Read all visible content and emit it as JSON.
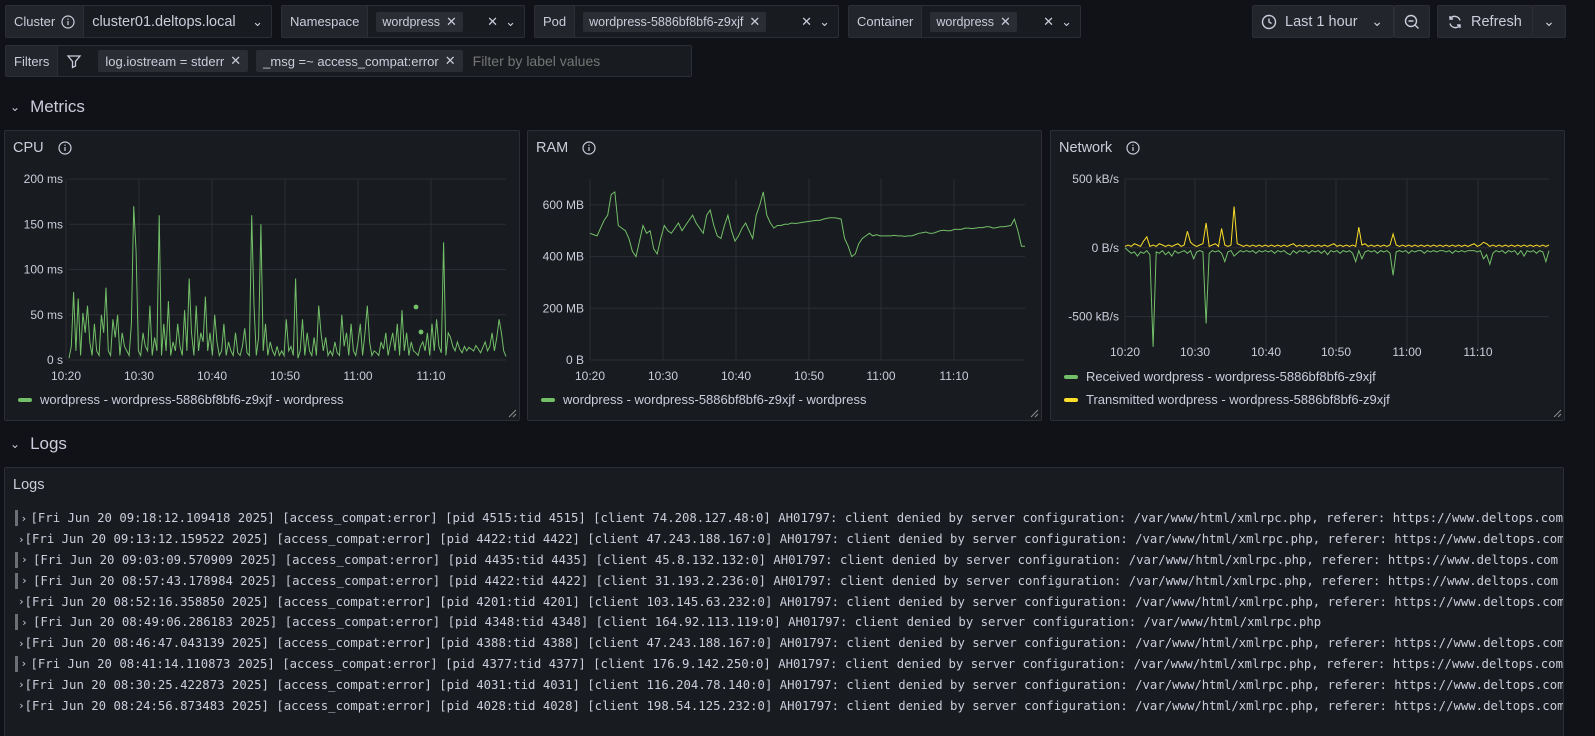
{
  "variables": {
    "cluster": {
      "label": "Cluster",
      "value": "cluster01.deltops.local"
    },
    "namespace": {
      "label": "Namespace",
      "value": "wordpress"
    },
    "pod": {
      "label": "Pod",
      "value": "wordpress-5886bf8bf6-z9xjf"
    },
    "container": {
      "label": "Container",
      "value": "wordpress"
    }
  },
  "filters": {
    "label": "Filters",
    "chips": [
      "log.iostream = stderr",
      "_msg =~ access_compat:error"
    ],
    "placeholder": "Filter by label values"
  },
  "toolbar": {
    "time_range": "Last 1 hour",
    "refresh_label": "Refresh"
  },
  "sections": {
    "metrics": "Metrics",
    "logs": "Logs"
  },
  "colors": {
    "green": "#73bf69",
    "yellow": "#fade2a"
  },
  "panels": {
    "cpu": {
      "title": "CPU",
      "legend": "wordpress - wordpress-5886bf8bf6-z9xjf - wordpress",
      "y_ticks": [
        "200 ms",
        "150 ms",
        "100 ms",
        "50 ms",
        "0 s"
      ],
      "x_ticks": [
        "10:20",
        "10:30",
        "10:40",
        "10:50",
        "11:00",
        "11:10"
      ]
    },
    "ram": {
      "title": "RAM",
      "legend": "wordpress - wordpress-5886bf8bf6-z9xjf - wordpress",
      "y_ticks": [
        "600 MB",
        "400 MB",
        "200 MB",
        "0 B"
      ],
      "x_ticks": [
        "10:20",
        "10:30",
        "10:40",
        "10:50",
        "11:00",
        "11:10"
      ]
    },
    "network": {
      "title": "Network",
      "legend_received": "Received wordpress - wordpress-5886bf8bf6-z9xjf",
      "legend_transmitted": "Transmitted wordpress - wordpress-5886bf8bf6-z9xjf",
      "y_ticks": [
        "500 kB/s",
        "0 B/s",
        "-500 kB/s"
      ],
      "x_ticks": [
        "10:20",
        "10:30",
        "10:40",
        "10:50",
        "11:00",
        "11:10"
      ]
    }
  },
  "chart_data": [
    {
      "type": "line",
      "title": "CPU",
      "ylim": [
        0,
        200
      ],
      "x_range": [
        "10:15",
        "11:19"
      ],
      "series": [
        {
          "name": "wordpress - wordpress-5886bf8bf6-z9xjf - wordpress",
          "values": [
            2,
            15,
            75,
            10,
            68,
            5,
            52,
            30,
            60,
            20,
            5,
            40,
            10,
            5,
            50,
            30,
            80,
            10,
            5,
            45,
            25,
            50,
            5,
            30,
            15,
            10,
            5,
            40,
            170,
            120,
            10,
            5,
            30,
            15,
            10,
            60,
            5,
            25,
            10,
            160,
            5,
            40,
            10,
            65,
            5,
            20,
            10,
            40,
            15,
            5,
            55,
            10,
            90,
            30,
            5,
            60,
            10,
            30,
            20,
            70,
            10,
            30,
            5,
            50,
            20,
            5,
            10,
            40,
            5,
            20,
            10,
            5,
            30,
            8,
            5,
            15,
            35,
            8,
            5,
            160,
            60,
            5,
            25,
            150,
            10,
            40,
            5,
            20,
            10,
            5,
            15,
            5,
            10,
            5,
            45,
            10,
            15,
            5,
            90,
            2,
            10,
            45,
            5,
            30,
            10,
            5,
            25,
            5,
            60,
            30,
            10,
            25,
            5,
            10,
            5,
            20,
            8,
            5,
            50,
            15,
            30,
            5,
            40,
            10,
            5,
            20,
            40,
            5,
            30,
            60,
            20,
            5,
            10,
            8,
            5,
            20,
            12,
            30,
            5,
            18,
            30,
            10,
            40,
            5,
            55,
            10,
            30,
            5,
            20,
            10,
            8,
            5,
            15,
            20,
            10,
            30,
            5,
            40,
            10,
            45,
            15,
            8,
            130,
            5,
            30,
            25,
            15,
            10,
            20,
            12,
            8,
            15,
            10,
            14,
            12,
            10,
            16,
            12,
            8,
            14,
            20,
            10,
            15,
            30,
            10,
            25,
            45,
            30,
            10,
            4
          ]
        }
      ]
    },
    {
      "type": "line",
      "title": "RAM",
      "ylim": [
        0,
        700
      ],
      "x_range": [
        "10:15",
        "11:19"
      ],
      "series": [
        {
          "name": "wordpress - wordpress-5886bf8bf6-z9xjf - wordpress",
          "values": [
            490,
            485,
            480,
            510,
            540,
            560,
            640,
            650,
            520,
            510,
            500,
            470,
            420,
            400,
            460,
            520,
            490,
            500,
            430,
            410,
            470,
            520,
            500,
            490,
            510,
            530,
            500,
            520,
            540,
            560,
            530,
            510,
            490,
            560,
            580,
            520,
            480,
            470,
            520,
            560,
            500,
            460,
            480,
            510,
            530,
            500,
            470,
            560,
            600,
            650,
            560,
            530,
            510,
            520,
            520,
            525,
            525,
            530,
            528,
            530,
            532,
            534,
            536,
            538,
            540,
            540,
            545,
            548,
            550,
            550,
            548,
            545,
            470,
            440,
            400,
            410,
            450,
            470,
            480,
            490,
            480,
            485,
            480,
            480,
            480,
            480,
            482,
            480,
            480,
            478,
            480,
            480,
            485,
            490,
            492,
            495,
            490,
            490,
            495,
            500,
            502,
            500,
            500,
            505,
            505,
            505,
            510,
            510,
            508,
            510,
            512,
            512,
            515,
            515,
            510,
            512,
            515,
            515,
            518,
            520,
            545,
            500,
            440,
            440
          ]
        }
      ]
    },
    {
      "type": "line",
      "title": "Network",
      "ylim": [
        -750,
        500
      ],
      "x_range": [
        "10:18",
        "11:19"
      ],
      "series": [
        {
          "name": "Received wordpress - wordpress-5886bf8bf6-z9xjf",
          "values": [
            0,
            -20,
            -40,
            -30,
            -60,
            -30,
            -40,
            -20,
            -50,
            -720,
            -30,
            -40,
            -20,
            -50,
            -30,
            -60,
            -20,
            -40,
            -30,
            -20,
            -40,
            -20,
            -80,
            -30,
            -20,
            -30,
            -550,
            -40,
            -20,
            -30,
            -20,
            -40,
            -100,
            -30,
            -20,
            -60,
            -40,
            -20,
            -30,
            -20,
            -30,
            -20,
            -40,
            -20,
            -30,
            -20,
            -30,
            -20,
            -40,
            -20,
            -30,
            -20,
            -40,
            -50,
            -20,
            -40,
            -20,
            -30,
            -20,
            -40,
            -20,
            -30,
            -20,
            -40,
            -20,
            -50,
            -20,
            -30,
            -20,
            -40,
            -20,
            -30,
            -20,
            -40,
            -100,
            -20,
            -80,
            -30,
            -20,
            -30,
            -20,
            -40,
            -20,
            -30,
            -20,
            -40,
            -200,
            -30,
            -20,
            -30,
            -20,
            -40,
            -20,
            -30,
            -20,
            -20,
            -40,
            -20,
            -30,
            -20,
            -30,
            -20,
            -20,
            -30,
            -20,
            -40,
            -20,
            -30,
            -20,
            -30,
            -20,
            -20,
            -20,
            -30,
            -20,
            -80,
            -50,
            -120,
            -40,
            -20,
            -30,
            -20,
            -40,
            -20,
            -30,
            -20,
            -50,
            -20,
            -60,
            -20,
            -30,
            -20,
            -40,
            -20,
            -30,
            -100,
            -20
          ]
        },
        {
          "name": "Transmitted wordpress - wordpress-5886bf8bf6-z9xjf",
          "values": [
            10,
            20,
            10,
            30,
            20,
            10,
            50,
            80,
            10,
            20,
            10,
            30,
            20,
            10,
            20,
            10,
            20,
            30,
            10,
            20,
            120,
            40,
            20,
            10,
            20,
            30,
            180,
            10,
            20,
            30,
            10,
            140,
            20,
            10,
            20,
            300,
            30,
            20,
            10,
            20,
            10,
            20,
            10,
            20,
            10,
            20,
            10,
            20,
            10,
            20,
            10,
            20,
            10,
            20,
            30,
            10,
            20,
            10,
            20,
            10,
            20,
            10,
            20,
            10,
            20,
            10,
            20,
            30,
            10,
            20,
            10,
            20,
            10,
            20,
            10,
            150,
            20,
            30,
            10,
            20,
            10,
            20,
            10,
            20,
            10,
            20,
            100,
            20,
            10,
            20,
            10,
            20,
            10,
            20,
            10,
            20,
            10,
            20,
            10,
            20,
            10,
            20,
            10,
            20,
            10,
            20,
            10,
            20,
            10,
            20,
            10,
            20,
            30,
            10,
            20,
            40,
            30,
            10,
            20,
            10,
            20,
            10,
            20,
            10,
            20,
            10,
            20,
            10,
            20,
            10,
            20,
            10,
            20,
            10,
            20,
            10,
            20
          ]
        }
      ]
    }
  ],
  "logs": {
    "title": "Logs",
    "lines": [
      "[Fri Jun 20 09:18:12.109418 2025] [access_compat:error] [pid 4515:tid 4515] [client 74.208.127.48:0] AH01797: client denied by server configuration: /var/www/html/xmlrpc.php, referer: https://www.deltops.com",
      "[Fri Jun 20 09:13:12.159522 2025] [access_compat:error] [pid 4422:tid 4422] [client 47.243.188.167:0] AH01797: client denied by server configuration: /var/www/html/xmlrpc.php, referer: https://www.deltops.com",
      "[Fri Jun 20 09:03:09.570909 2025] [access_compat:error] [pid 4435:tid 4435] [client 45.8.132.132:0] AH01797: client denied by server configuration: /var/www/html/xmlrpc.php, referer: https://www.deltops.com",
      "[Fri Jun 20 08:57:43.178984 2025] [access_compat:error] [pid 4422:tid 4422] [client 31.193.2.236:0] AH01797: client denied by server configuration: /var/www/html/xmlrpc.php, referer: https://www.deltops.com",
      "[Fri Jun 20 08:52:16.358850 2025] [access_compat:error] [pid 4201:tid 4201] [client 103.145.63.232:0] AH01797: client denied by server configuration: /var/www/html/xmlrpc.php, referer: https://www.deltops.com",
      "[Fri Jun 20 08:49:06.286183 2025] [access_compat:error] [pid 4348:tid 4348] [client 164.92.113.119:0] AH01797: client denied by server configuration: /var/www/html/xmlrpc.php",
      "[Fri Jun 20 08:46:47.043139 2025] [access_compat:error] [pid 4388:tid 4388] [client 47.243.188.167:0] AH01797: client denied by server configuration: /var/www/html/xmlrpc.php, referer: https://www.deltops.com",
      "[Fri Jun 20 08:41:14.110873 2025] [access_compat:error] [pid 4377:tid 4377] [client 176.9.142.250:0] AH01797: client denied by server configuration: /var/www/html/xmlrpc.php, referer: https://www.deltops.com",
      "[Fri Jun 20 08:30:25.422873 2025] [access_compat:error] [pid 4031:tid 4031] [client 116.204.78.140:0] AH01797: client denied by server configuration: /var/www/html/xmlrpc.php, referer: https://www.deltops.com",
      "[Fri Jun 20 08:24:56.873483 2025] [access_compat:error] [pid 4028:tid 4028] [client 198.54.125.232:0] AH01797: client denied by server configuration: /var/www/html/xmlrpc.php, referer: https://www.deltops.com"
    ]
  }
}
